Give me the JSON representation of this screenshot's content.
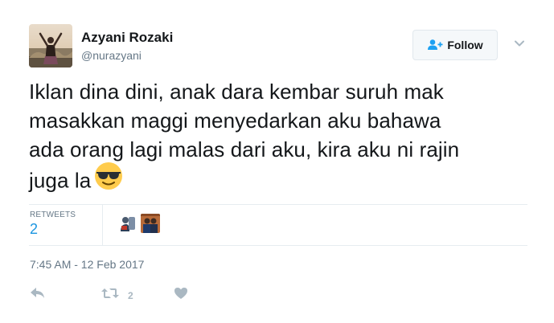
{
  "tweet": {
    "author": {
      "display_name": "Azyani Rozaki",
      "screen_name": "@nurazyani"
    },
    "follow_button": {
      "label": "Follow"
    },
    "text_lines": [
      "Iklan dina dini, anak dara kembar suruh mak",
      "masakkan maggi menyedarkan aku bahawa",
      "ada orang lagi malas dari aku, kira aku ni rajin",
      "juga la"
    ],
    "emoji": "smiling-face-with-sunglasses",
    "stats": {
      "retweets_label": "RETWEETS",
      "retweets_count": "2"
    },
    "timestamp": "7:45 AM - 12 Feb 2017",
    "actions": {
      "retweet_count": "2"
    }
  },
  "colors": {
    "text": "#14171a",
    "secondary": "#657786",
    "link": "#1b95e0",
    "action_icon": "#aab8c2",
    "divider": "#e6ecf0"
  }
}
